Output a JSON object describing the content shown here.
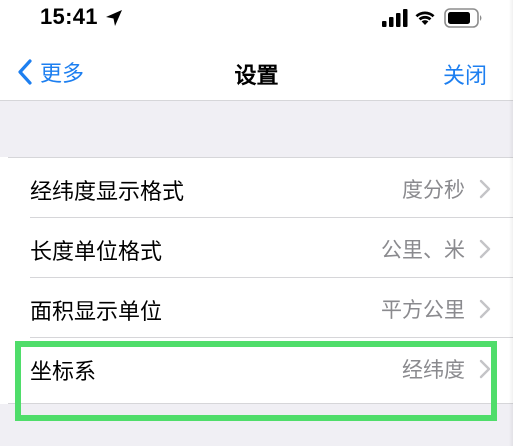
{
  "status_bar": {
    "time": "15:41",
    "icons": [
      "location-arrow-icon",
      "cellular-signal-icon",
      "wifi-icon",
      "battery-icon"
    ]
  },
  "nav": {
    "back_label": "更多",
    "title": "设置",
    "close_label": "关闭"
  },
  "settings": [
    {
      "label": "经纬度显示格式",
      "value": "度分秒"
    },
    {
      "label": "长度单位格式",
      "value": "公里、米"
    },
    {
      "label": "面积显示单位",
      "value": "平方公里"
    },
    {
      "label": "坐标系",
      "value": "经纬度"
    }
  ],
  "colors": {
    "accent_blue": "#1d7ff0",
    "value_gray": "#8a8a8e",
    "grouped_background": "#f0eff4",
    "highlight_green": "#4fdd6a"
  }
}
